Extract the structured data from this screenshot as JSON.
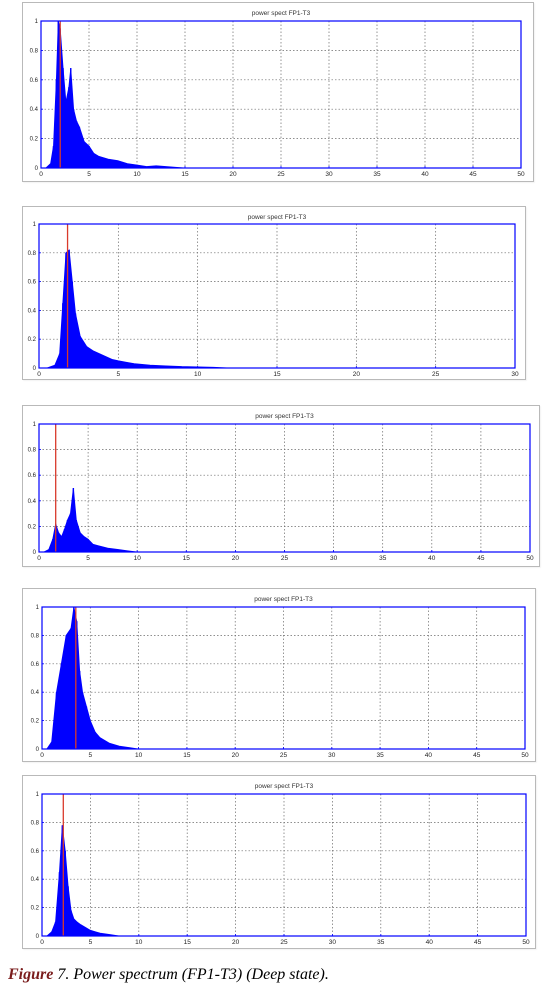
{
  "figure": {
    "caption_label": "Figure",
    "caption_text": " 7. Power spectrum (FP1-T3) (Deep state)."
  },
  "colors": {
    "spectrum": "#0000ff",
    "marker": "#d93a2b",
    "axes": "#0000ff",
    "grid": "#6a6a6a"
  },
  "chart_data": [
    {
      "type": "area",
      "title": "power spect FP1-T3",
      "xlim": [
        0,
        50
      ],
      "ylim": [
        0,
        1
      ],
      "xticks": [
        0,
        5,
        10,
        15,
        20,
        25,
        30,
        35,
        40,
        45,
        50
      ],
      "yticks": [
        0,
        0.2,
        0.4,
        0.6,
        0.8,
        1
      ],
      "grid": true,
      "peak_marker_x": 2.0,
      "series": [
        {
          "x": [
            0.5,
            1.0,
            1.3,
            1.6,
            1.8,
            2.0,
            2.3,
            2.6,
            2.9,
            3.1,
            3.4,
            3.7,
            4.0,
            4.5,
            5.0,
            5.5,
            6.0,
            7.0,
            8.0,
            9.0,
            10.0,
            11.0,
            12.0,
            13.0,
            14.0,
            15.0
          ],
          "values": [
            0.0,
            0.03,
            0.15,
            0.6,
            1.0,
            0.95,
            0.68,
            0.45,
            0.55,
            0.68,
            0.4,
            0.32,
            0.28,
            0.18,
            0.15,
            0.1,
            0.08,
            0.06,
            0.05,
            0.03,
            0.02,
            0.01,
            0.015,
            0.01,
            0.005,
            0.0
          ]
        }
      ]
    },
    {
      "type": "area",
      "title": "power spect FP1-T3",
      "xlim": [
        0,
        30
      ],
      "ylim": [
        0,
        1
      ],
      "xticks": [
        0,
        5,
        10,
        15,
        20,
        25,
        30
      ],
      "yticks": [
        0,
        0.2,
        0.4,
        0.6,
        0.8,
        1
      ],
      "grid": true,
      "peak_marker_x": 1.8,
      "series": [
        {
          "x": [
            0.5,
            1.0,
            1.3,
            1.5,
            1.7,
            1.9,
            2.1,
            2.3,
            2.6,
            3.0,
            3.4,
            3.8,
            4.2,
            4.6,
            5.0,
            5.5,
            6.0,
            7.0,
            8.0,
            9.0,
            10.0,
            11.0,
            12.0
          ],
          "values": [
            0.0,
            0.02,
            0.1,
            0.45,
            0.8,
            0.82,
            0.6,
            0.38,
            0.22,
            0.15,
            0.12,
            0.1,
            0.08,
            0.06,
            0.05,
            0.04,
            0.03,
            0.02,
            0.015,
            0.01,
            0.008,
            0.005,
            0.0
          ]
        }
      ]
    },
    {
      "type": "area",
      "title": "power spect FP1-T3",
      "xlim": [
        0,
        50
      ],
      "ylim": [
        0,
        1
      ],
      "xticks": [
        0,
        5,
        10,
        15,
        20,
        25,
        30,
        35,
        40,
        45,
        50
      ],
      "yticks": [
        0,
        0.2,
        0.4,
        0.6,
        0.8,
        1
      ],
      "grid": true,
      "peak_marker_x": 1.7,
      "series": [
        {
          "x": [
            0.5,
            1.0,
            1.4,
            1.7,
            2.0,
            2.3,
            2.6,
            2.9,
            3.2,
            3.5,
            3.8,
            4.2,
            4.6,
            5.0,
            5.5,
            6.0,
            7.0,
            8.0,
            9.0,
            10.0
          ],
          "values": [
            0.0,
            0.02,
            0.1,
            0.22,
            0.15,
            0.12,
            0.18,
            0.25,
            0.3,
            0.5,
            0.25,
            0.15,
            0.12,
            0.1,
            0.06,
            0.05,
            0.03,
            0.02,
            0.01,
            0.0
          ]
        }
      ]
    },
    {
      "type": "area",
      "title": "power spect FP1-T3",
      "xlim": [
        0,
        50
      ],
      "ylim": [
        0,
        1
      ],
      "xticks": [
        0,
        5,
        10,
        15,
        20,
        25,
        30,
        35,
        40,
        45,
        50
      ],
      "yticks": [
        0,
        0.2,
        0.4,
        0.6,
        0.8,
        1
      ],
      "grid": true,
      "peak_marker_x": 3.5,
      "series": [
        {
          "x": [
            0.5,
            1.0,
            1.5,
            2.0,
            2.5,
            3.0,
            3.3,
            3.6,
            3.9,
            4.2,
            4.6,
            5.0,
            5.5,
            6.0,
            6.5,
            7.0,
            8.0,
            9.0,
            10.0
          ],
          "values": [
            0.0,
            0.05,
            0.4,
            0.6,
            0.8,
            0.85,
            1.0,
            0.9,
            0.55,
            0.4,
            0.3,
            0.2,
            0.12,
            0.08,
            0.06,
            0.04,
            0.02,
            0.01,
            0.0
          ]
        }
      ]
    },
    {
      "type": "area",
      "title": "power spect FP1-T3",
      "xlim": [
        0,
        50
      ],
      "ylim": [
        0,
        1
      ],
      "xticks": [
        0,
        5,
        10,
        15,
        20,
        25,
        30,
        35,
        40,
        45,
        50
      ],
      "yticks": [
        0,
        0.2,
        0.4,
        0.6,
        0.8,
        1
      ],
      "grid": true,
      "peak_marker_x": 2.2,
      "series": [
        {
          "x": [
            0.5,
            1.0,
            1.4,
            1.8,
            2.1,
            2.4,
            2.7,
            3.0,
            3.3,
            3.6,
            4.0,
            4.5,
            5.0,
            5.5,
            6.0,
            7.0,
            8.0
          ],
          "values": [
            0.0,
            0.03,
            0.1,
            0.45,
            0.78,
            0.6,
            0.35,
            0.18,
            0.12,
            0.1,
            0.08,
            0.06,
            0.04,
            0.03,
            0.02,
            0.01,
            0.0
          ]
        }
      ]
    }
  ]
}
